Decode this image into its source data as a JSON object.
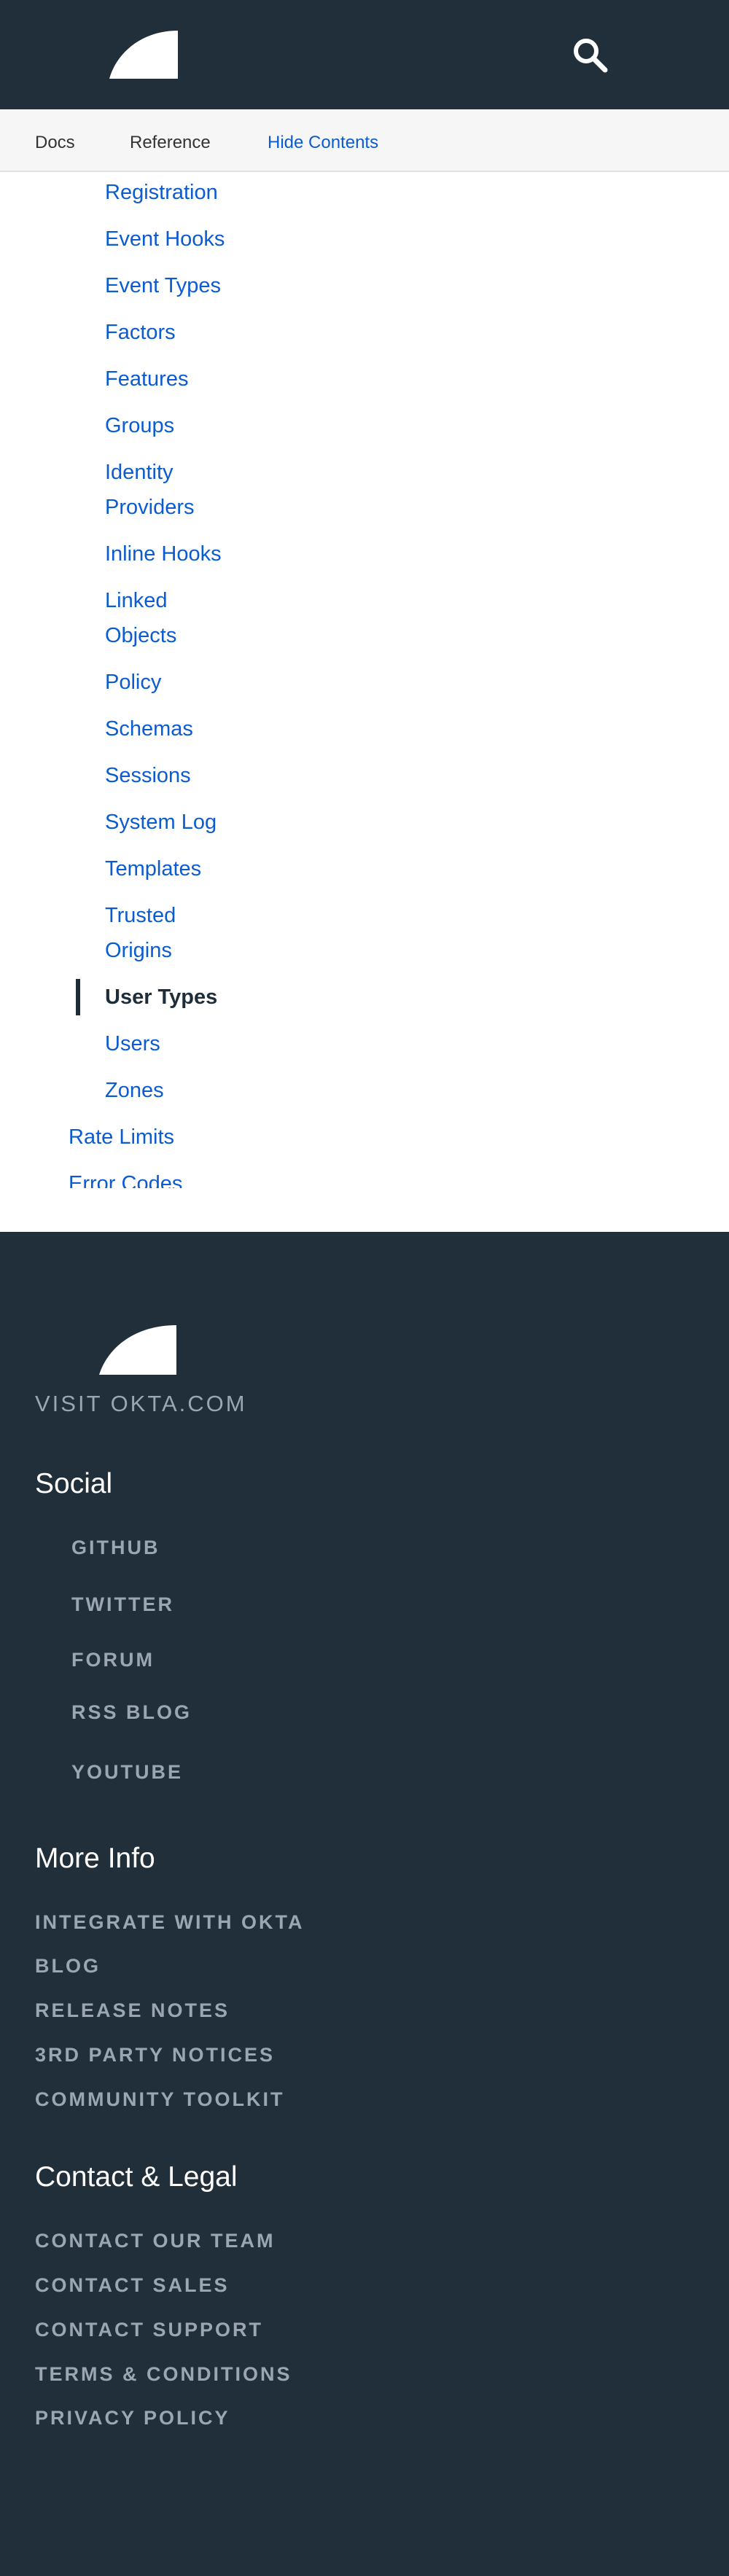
{
  "colors": {
    "header_bg": "#212f3a",
    "link": "#0b5bd1",
    "active": "#1f2d38",
    "footer_link": "#9aa6b1"
  },
  "header": {
    "logo_icon": "okta-logo-icon",
    "search_icon": "search-icon"
  },
  "subnav": {
    "docs": "Docs",
    "reference": "Reference",
    "hide_contents": "Hide Contents"
  },
  "toc": {
    "items": [
      "Registration",
      "Event Hooks",
      "Event Types",
      "Factors",
      "Features",
      "Groups",
      "Identity",
      "Providers",
      "Inline Hooks",
      "Linked",
      "Objects",
      "Policy",
      "Schemas",
      "Sessions",
      "System Log",
      "Templates",
      "Trusted",
      "Origins",
      "User Types",
      "Users",
      "Zones",
      "Rate Limits",
      "Error Codes"
    ],
    "active": "User Types"
  },
  "footer": {
    "visit": "VISIT OKTA.COM",
    "social_heading": "Social",
    "social": [
      "GITHUB",
      "TWITTER",
      "FORUM",
      "RSS BLOG",
      "YOUTUBE"
    ],
    "more_heading": "More Info",
    "more": [
      "INTEGRATE WITH OKTA",
      "BLOG",
      "RELEASE NOTES",
      "3RD PARTY NOTICES",
      "COMMUNITY TOOLKIT"
    ],
    "contact_heading": "Contact & Legal",
    "contact": [
      "CONTACT OUR TEAM",
      "CONTACT SALES",
      "CONTACT SUPPORT",
      "TERMS & CONDITIONS",
      "PRIVACY POLICY"
    ]
  }
}
